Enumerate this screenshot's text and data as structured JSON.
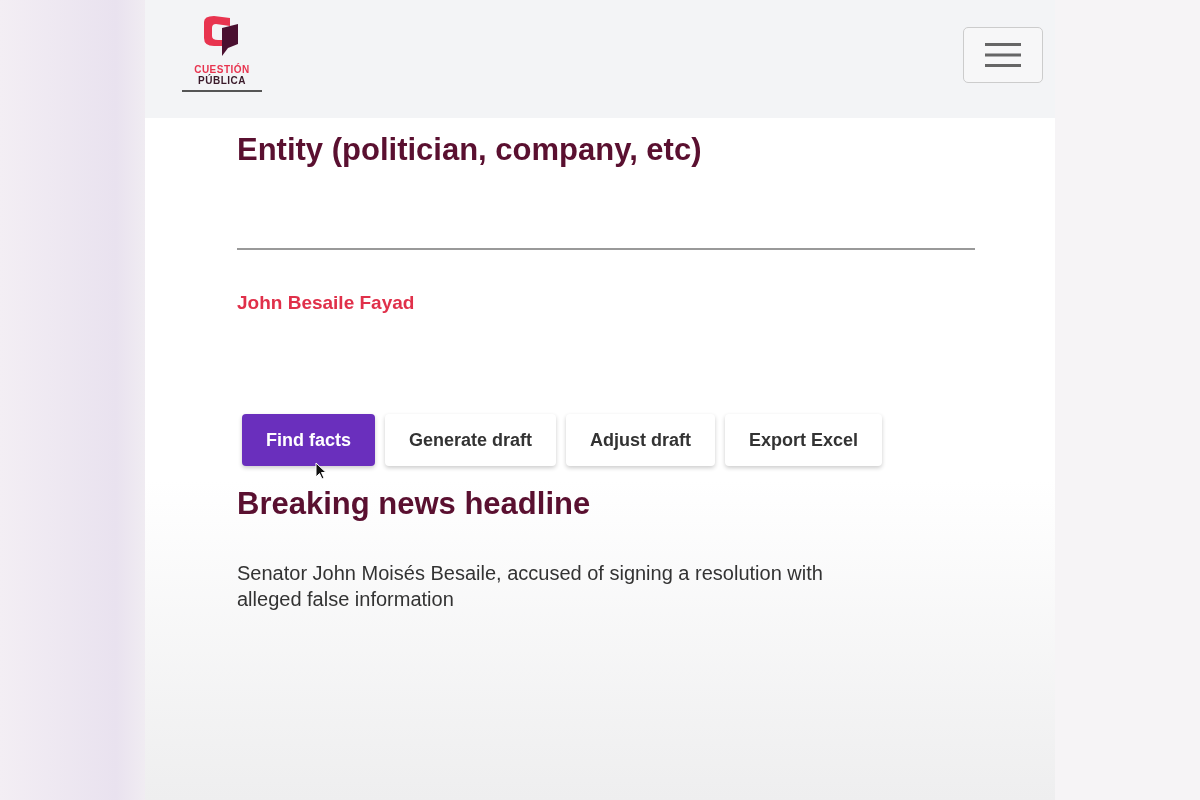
{
  "header": {
    "logo": {
      "line_1": "CUESTIÓN",
      "line_2": "PÚBLICA"
    }
  },
  "entity": {
    "label": "Entity (politician, company, etc)",
    "result": "John Besaile Fayad"
  },
  "buttons": [
    {
      "label": "Find facts",
      "kind": "primary"
    },
    {
      "label": "Generate draft",
      "kind": "secondary"
    },
    {
      "label": "Adjust draft",
      "kind": "secondary"
    },
    {
      "label": "Export Excel",
      "kind": "secondary"
    }
  ],
  "headline": {
    "title": "Breaking news headline",
    "text": "Senator John Moisés Besaile, accused of signing a resolution with alleged false information"
  }
}
